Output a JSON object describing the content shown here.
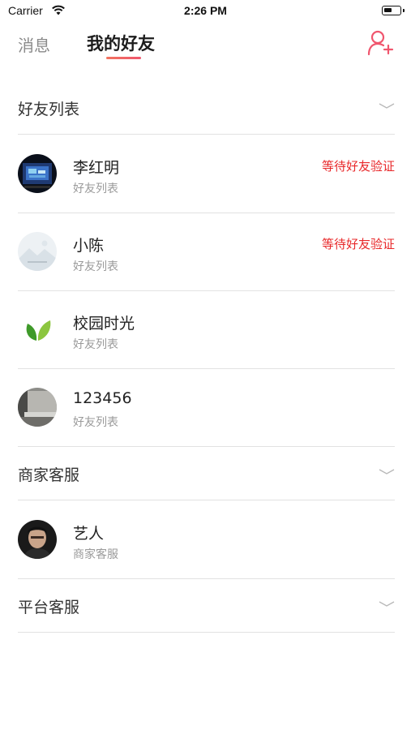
{
  "status_bar": {
    "carrier": "Carrier",
    "time": "2:26 PM"
  },
  "nav": {
    "tab_messages": "消息",
    "tab_friends": "我的好友",
    "active_tab": "我的好友"
  },
  "colors": {
    "accent": "#f0566e",
    "pending": "#e8282a"
  },
  "sections": [
    {
      "title": "好友列表",
      "contacts": [
        {
          "name": "李红明",
          "group": "好友列表",
          "status": "等待好友验证",
          "avatar": "screen-photo"
        },
        {
          "name": "小陈",
          "group": "好友列表",
          "status": "等待好友验证",
          "avatar": "landscape-placeholder"
        },
        {
          "name": "校园时光",
          "group": "好友列表",
          "status": "",
          "avatar": "leaf-logo"
        },
        {
          "name": "123456",
          "group": "好友列表",
          "status": "",
          "avatar": "room-photo"
        }
      ]
    },
    {
      "title": "商家客服",
      "contacts": [
        {
          "name": "艺人",
          "group": "商家客服",
          "status": "",
          "avatar": "person-photo"
        }
      ]
    },
    {
      "title": "平台客服",
      "contacts": []
    }
  ]
}
